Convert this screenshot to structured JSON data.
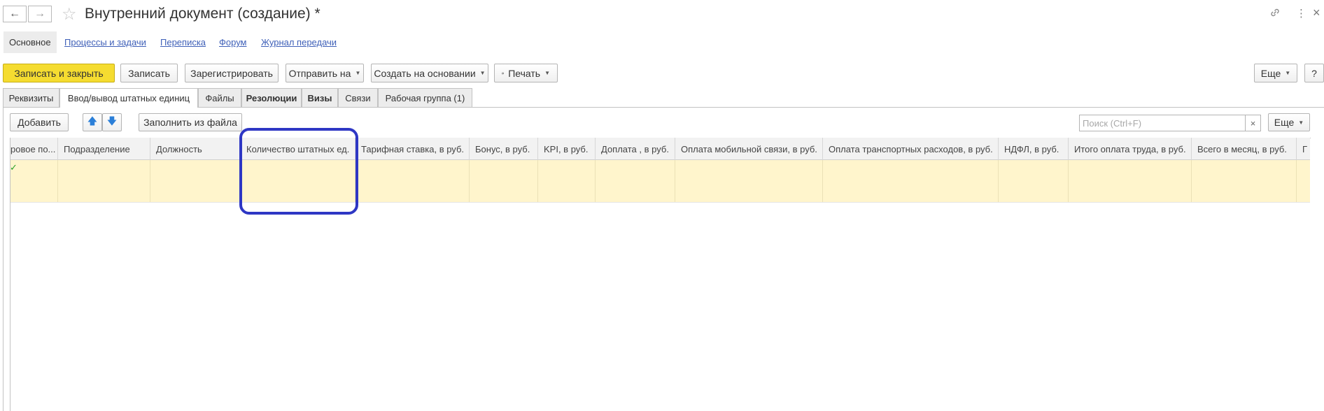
{
  "window": {
    "title": "Внутренний документ (создание) *",
    "back_icon": "←",
    "forward_icon": "→",
    "star_icon": "☆",
    "link_icon": "🔗",
    "more_icon": "⋮",
    "close_icon": "×"
  },
  "sections": [
    "Основное",
    "Процессы и задачи",
    "Переписка",
    "Форум",
    "Журнал передачи"
  ],
  "toolbar": {
    "save_close": "Записать и закрыть",
    "save": "Записать",
    "register": "Зарегистрировать",
    "send_to": "Отправить на",
    "create_based": "Создать на основании",
    "print": "Печать",
    "more": "Еще",
    "help": "?"
  },
  "tabs": [
    "Реквизиты",
    "Ввод/вывод штатных единиц",
    "Файлы",
    "Резолюции",
    "Визы",
    "Связи",
    "Рабочая группа (1)"
  ],
  "table_toolbar": {
    "add": "Добавить",
    "up_icon": "🡅",
    "down_icon": "🡇",
    "fill_from_file": "Заполнить из файла",
    "search_placeholder": "Поиск (Ctrl+F)",
    "clear": "×",
    "more": "Еще"
  },
  "columns": [
    "ровое по...",
    "Подразделение",
    "Должность",
    "Количество штатных ед.",
    "Тарифная ставка, в руб.",
    "Бонус, в руб.",
    "KPI, в руб.",
    "Доплата , в руб.",
    "Оплата мобильной связи, в руб.",
    "Оплата транспортных расходов, в руб.",
    "НДФЛ, в руб.",
    "Итого оплата труда, в руб.",
    "Всего в месяц, в руб.",
    "Г"
  ],
  "row_check": "✓",
  "colors": {
    "accent_yellow": "#f5dc30",
    "row_highlight": "#fff5cc",
    "annotation_blue": "#2e37c4",
    "link_blue": "#3f60b8"
  }
}
